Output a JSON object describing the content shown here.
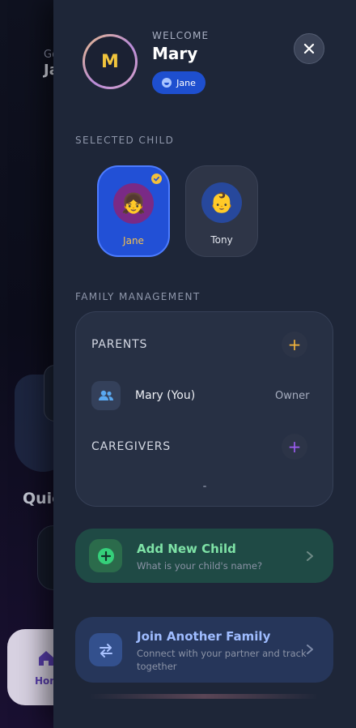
{
  "background": {
    "greeting_small": "Go",
    "greeting_name": "Ja",
    "quick_label": "Quic",
    "home_label": "Hom"
  },
  "drawer": {
    "avatar_initial": "M",
    "welcome_label": "WELCOME",
    "user_name": "Mary",
    "active_child_pill": "Jane",
    "selected_child_section": "SELECTED CHILD",
    "children": [
      {
        "name": "Jane",
        "emoji": "👧",
        "selected": true
      },
      {
        "name": "Tony",
        "emoji": "👶",
        "selected": false
      }
    ],
    "family_section": "FAMILY MANAGEMENT",
    "parents_heading": "PARENTS",
    "parent": {
      "name": "Mary (You)",
      "role": "Owner"
    },
    "caregivers_heading": "CAREGIVERS",
    "add_child": {
      "title": "Add New Child",
      "subtitle": "What is your child's name?"
    },
    "join_family": {
      "title": "Join Another Family",
      "subtitle": "Connect with your partner and track together"
    }
  },
  "colors": {
    "drawer_bg": "#1e2638",
    "selected_child": "#2250d6",
    "accent_yellow": "#f2c03b",
    "plus_purple": "#9b5cf0",
    "add_green": "#7ee2a6",
    "join_blue": "#9fbcff"
  }
}
